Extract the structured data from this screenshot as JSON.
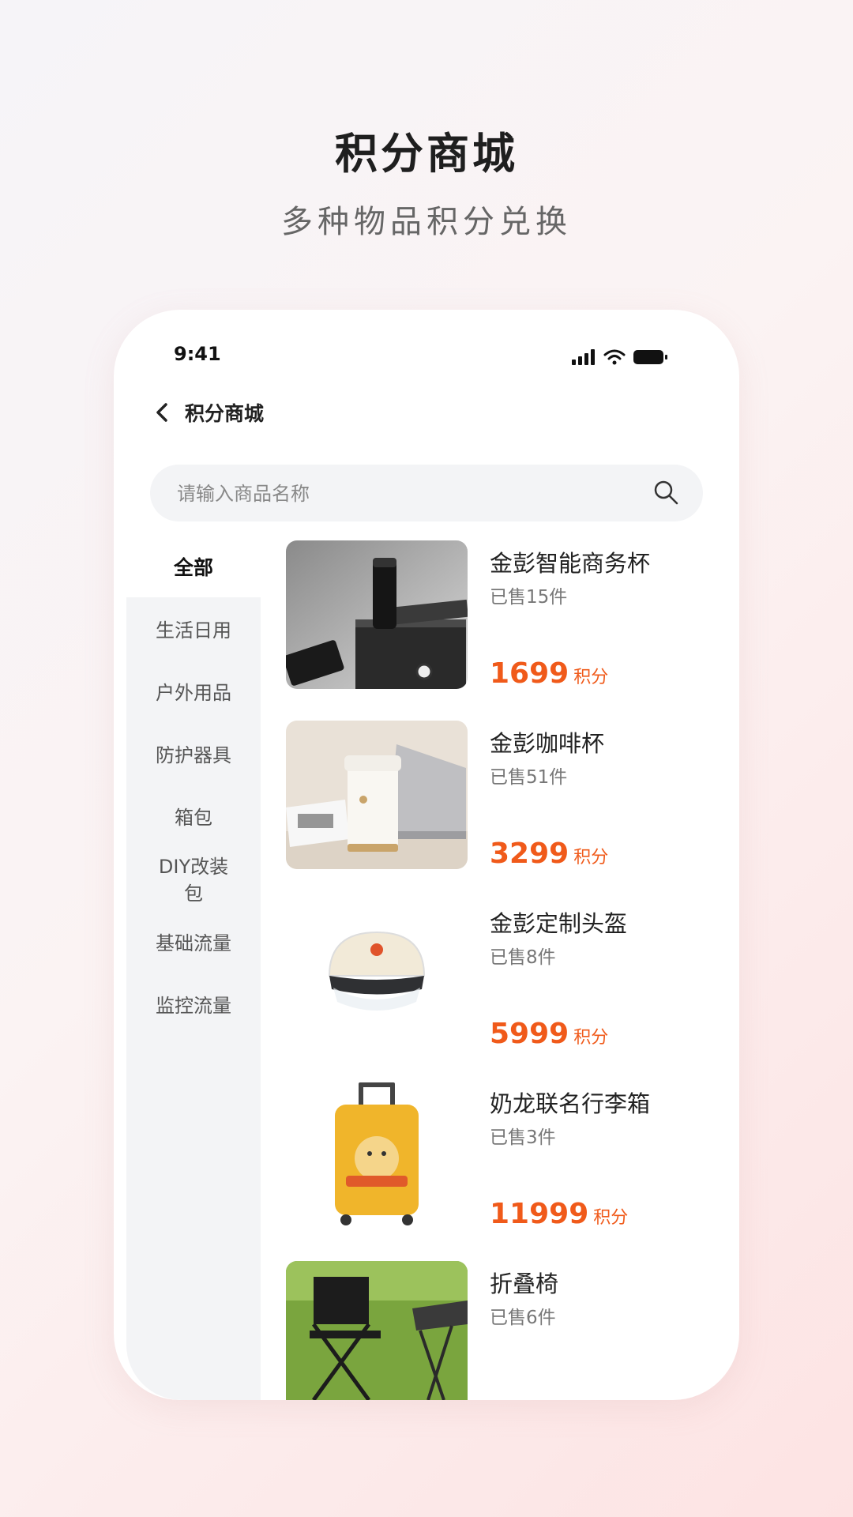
{
  "promo": {
    "title": "积分商城",
    "subtitle": "多种物品积分兑换"
  },
  "status": {
    "time": "9:41"
  },
  "nav": {
    "title": "积分商城"
  },
  "search": {
    "placeholder": "请输入商品名称"
  },
  "categories": [
    {
      "label": "全部",
      "active": true
    },
    {
      "label": "生活日用"
    },
    {
      "label": "户外用品"
    },
    {
      "label": "防护器具"
    },
    {
      "label": "箱包"
    },
    {
      "label": "DIY改装包"
    },
    {
      "label": "基础流量"
    },
    {
      "label": "监控流量"
    }
  ],
  "products": [
    {
      "name": "金彭智能商务杯",
      "sold": "已售15件",
      "price": "1699",
      "unit": "积分"
    },
    {
      "name": "金彭咖啡杯",
      "sold": "已售51件",
      "price": "3299",
      "unit": "积分"
    },
    {
      "name": "金彭定制头盔",
      "sold": "已售8件",
      "price": "5999",
      "unit": "积分"
    },
    {
      "name": "奶龙联名行李箱",
      "sold": "已售3件",
      "price": "11999",
      "unit": "积分"
    },
    {
      "name": "折叠椅",
      "sold": "已售6件"
    }
  ],
  "colors": {
    "accent": "#f05a1a",
    "sidebar_bg": "#f3f4f6"
  }
}
